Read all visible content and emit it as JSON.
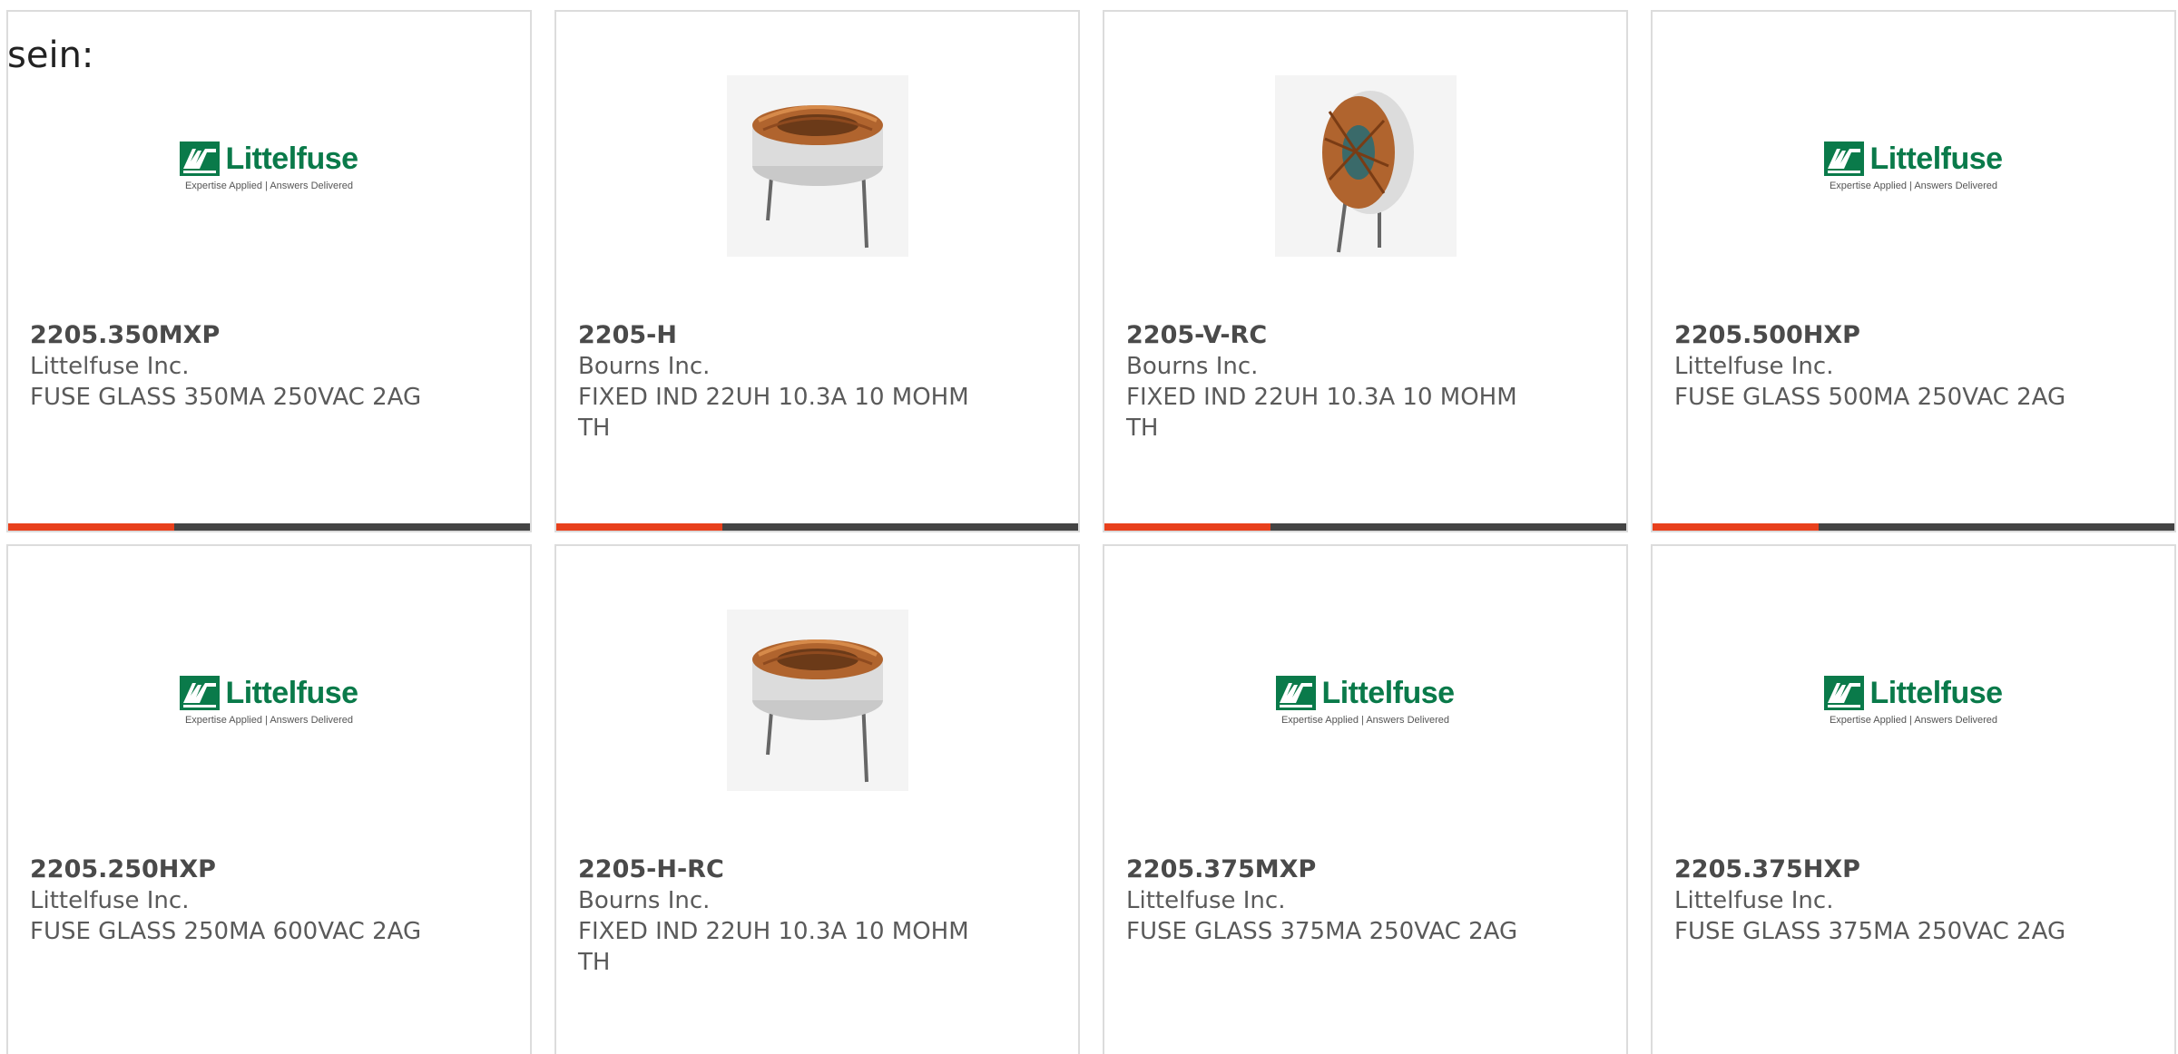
{
  "intro_text": "sein:",
  "colors": {
    "accent": "#e8401c",
    "bar_dark": "#444444",
    "logo_green": "#0a7a4a",
    "coil_copper": "#b5652e",
    "core_white": "#d8d8d8"
  },
  "logo": {
    "word": "Littelfuse",
    "tagline": "Expertise Applied | Answers Delivered"
  },
  "cards": [
    {
      "part_number": "2205.350MXP",
      "manufacturer": "Littelfuse Inc.",
      "description": "FUSE GLASS 350MA 250VAC 2AG",
      "image": "littelfuse-logo"
    },
    {
      "part_number": "2205-H",
      "manufacturer": "Bourns Inc.",
      "description": "FIXED IND 22UH 10.3A 10 MOHM TH",
      "image": "horizontal-toroid-inductor"
    },
    {
      "part_number": "2205-V-RC",
      "manufacturer": "Bourns Inc.",
      "description": "FIXED IND 22UH 10.3A 10 MOHM TH",
      "image": "vertical-toroid-inductor"
    },
    {
      "part_number": "2205.500HXP",
      "manufacturer": "Littelfuse Inc.",
      "description": "FUSE GLASS 500MA 250VAC 2AG",
      "image": "littelfuse-logo"
    },
    {
      "part_number": "2205.250HXP",
      "manufacturer": "Littelfuse Inc.",
      "description": "FUSE GLASS 250MA 600VAC 2AG",
      "image": "littelfuse-logo"
    },
    {
      "part_number": "2205-H-RC",
      "manufacturer": "Bourns Inc.",
      "description": "FIXED IND 22UH 10.3A 10 MOHM TH",
      "image": "horizontal-toroid-inductor"
    },
    {
      "part_number": "2205.375MXP",
      "manufacturer": "Littelfuse Inc.",
      "description": "FUSE GLASS 375MA 250VAC 2AG",
      "image": "littelfuse-logo"
    },
    {
      "part_number": "2205.375HXP",
      "manufacturer": "Littelfuse Inc.",
      "description": "FUSE GLASS 375MA 250VAC 2AG",
      "image": "littelfuse-logo"
    }
  ]
}
